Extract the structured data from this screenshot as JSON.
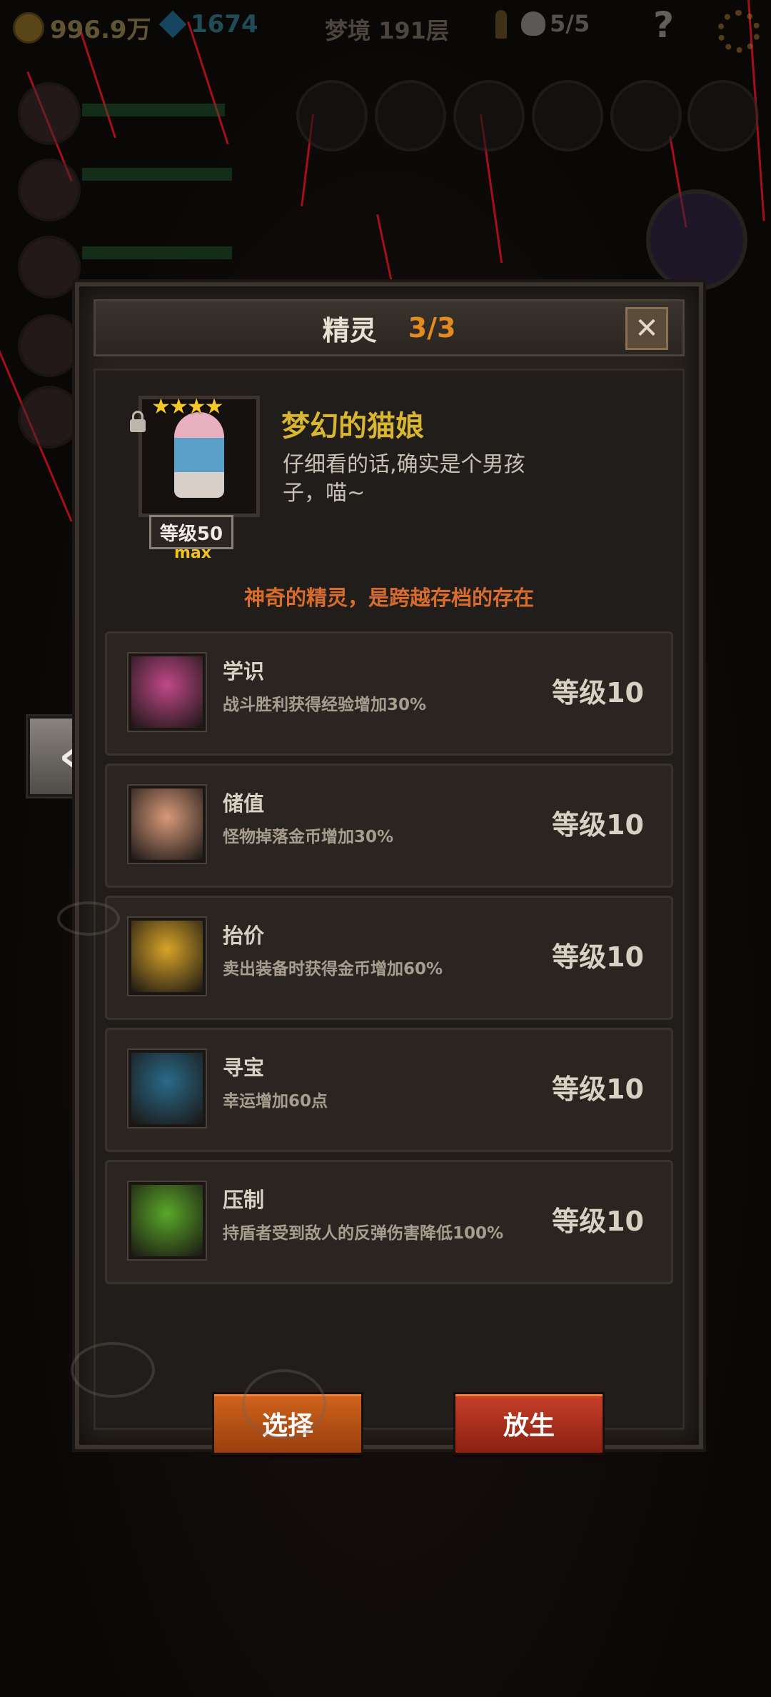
{
  "hud": {
    "gold": "996.9万",
    "gems": "1674",
    "floor": "梦境 191层",
    "kills": "5/5",
    "help": "?"
  },
  "dialog": {
    "title": "精灵",
    "count": "3/3",
    "close": "✕",
    "spirit": {
      "stars": "★★★★",
      "name": "梦幻的猫娘",
      "description": "仔细看的话,确实是个男孩子，喵~",
      "level": "等级50",
      "max": "max"
    },
    "tagline": "神奇的精灵，是跨越存档的存在",
    "skills": [
      {
        "name": "学识",
        "desc": "战斗胜利获得经验增加30%",
        "level": "等级10",
        "icon": "mind-face-icon",
        "color": "#c04888"
      },
      {
        "name": "储值",
        "desc": "怪物掉落金币增加30%",
        "level": "等级10",
        "icon": "goblet-icon",
        "color": "#d89a7a"
      },
      {
        "name": "抬价",
        "desc": "卖出装备时获得金币增加60%",
        "level": "等级10",
        "icon": "open-hand-icon",
        "color": "#d8a428"
      },
      {
        "name": "寻宝",
        "desc": "幸运增加60点",
        "level": "等级10",
        "icon": "sparkle-silhouette-icon",
        "color": "#2a6a8a"
      },
      {
        "name": "压制",
        "desc": "持盾者受到敌人的反弹伤害降低100%",
        "level": "等级10",
        "icon": "claw-grass-icon",
        "color": "#5aa828"
      }
    ],
    "buttons": {
      "select": "选择",
      "release": "放生"
    }
  },
  "nav": {
    "left_arrow": "‹"
  }
}
